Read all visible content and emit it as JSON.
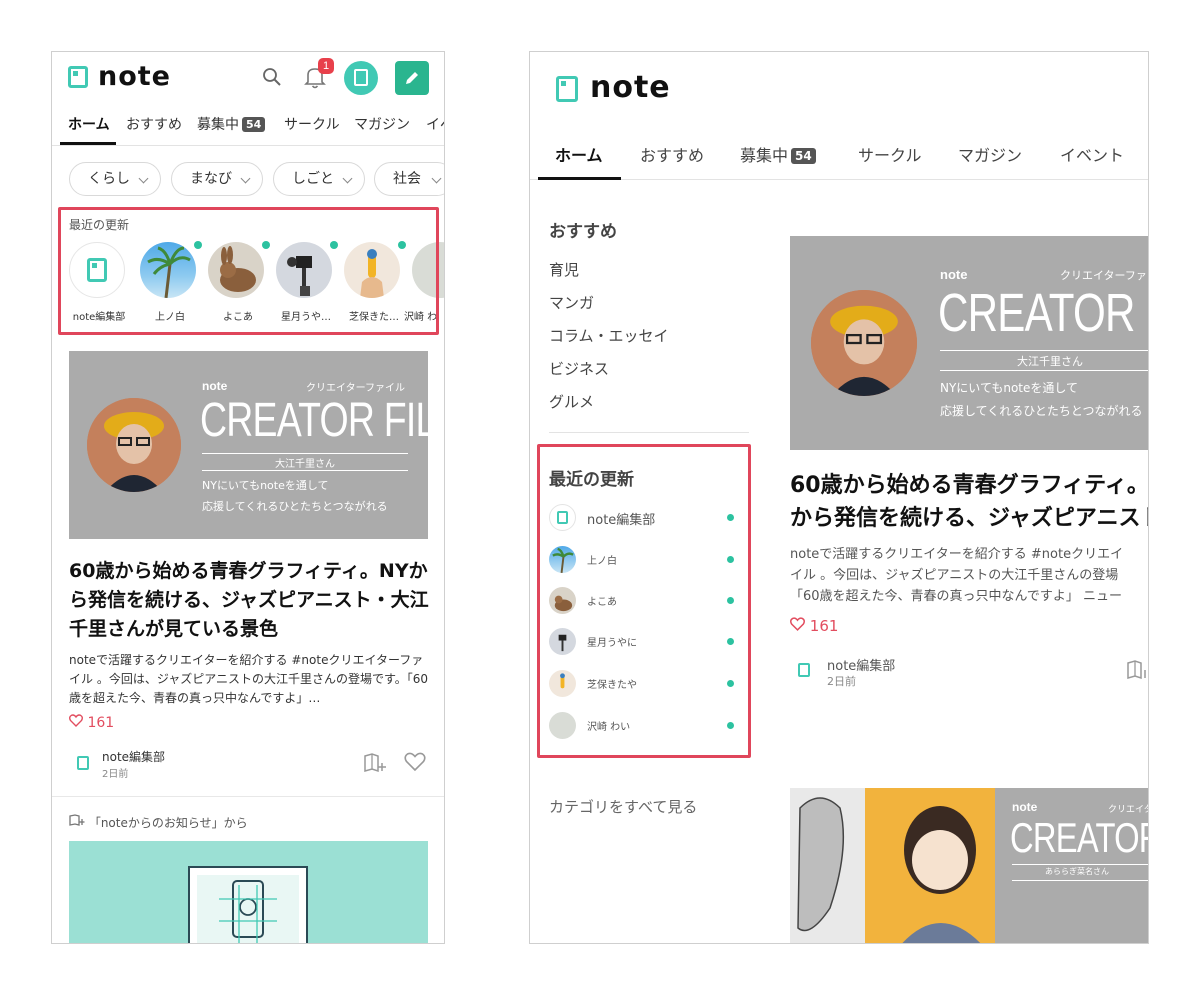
{
  "colors": {
    "accent": "#41c9b4",
    "highlight": "#e0465b",
    "like": "#e24d5f",
    "online": "#2cc2a0"
  },
  "left": {
    "logo": "note",
    "notification_count": "1",
    "tabs": [
      {
        "label": "ホーム",
        "active": true
      },
      {
        "label": "おすすめ"
      },
      {
        "label": "募集中",
        "count": "54"
      },
      {
        "label": "サークル"
      },
      {
        "label": "マガジン"
      },
      {
        "label": "イベ"
      }
    ],
    "chips": [
      "くらし",
      "まなび",
      "しごと",
      "社会"
    ],
    "recent_title": "最近の更新",
    "recent": [
      {
        "name": "note編集部",
        "icon": "note-logo-icon"
      },
      {
        "name": "上ノ白",
        "icon": "palm-tree-photo"
      },
      {
        "name": "よこあ",
        "icon": "rabbit-photo"
      },
      {
        "name": "星月うや…",
        "icon": "camera-photo"
      },
      {
        "name": "芝保きた…",
        "icon": "illustration-photo"
      },
      {
        "name": "沢崎 わ",
        "icon": "gray-photo"
      }
    ],
    "banner": {
      "note": "note",
      "label": "クリエイターファイル",
      "title": "CREATOR FILE",
      "name": "大江千里さん",
      "desc1": "NYにいてもnoteを通して",
      "desc2": "応援してくれるひとたちとつながれる"
    },
    "article": {
      "title": "60歳から始める青春グラフィティ。NYから発信を続ける、ジャズピアニスト・大江千里さんが見ている景色",
      "desc": "noteで活躍するクリエイターを紹介する #noteクリエイターファイル 。今回は、ジャズピアニストの大江千里さんの登場です。「60歳を超えた今、青春の真っ只中なんですよ」…",
      "likes": "161",
      "author": "note編集部",
      "time": "2日前"
    },
    "source": "「noteからのお知らせ」から"
  },
  "right": {
    "logo": "note",
    "tabs": [
      {
        "label": "ホーム",
        "active": true
      },
      {
        "label": "おすすめ"
      },
      {
        "label": "募集中",
        "count": "54"
      },
      {
        "label": "サークル"
      },
      {
        "label": "マガジン"
      },
      {
        "label": "イベント"
      }
    ],
    "sidebar": {
      "recommend_title": "おすすめ",
      "recommend_items": [
        "育児",
        "マンガ",
        "コラム・エッセイ",
        "ビジネス",
        "グルメ"
      ],
      "recent_title": "最近の更新",
      "recent": [
        {
          "name": "note編集部",
          "icon": "note-logo-icon"
        },
        {
          "name": "上ノ白",
          "icon": "palm-tree-photo"
        },
        {
          "name": "よこあ",
          "icon": "rabbit-photo"
        },
        {
          "name": "星月うやに",
          "icon": "camera-photo"
        },
        {
          "name": "芝保きたや",
          "icon": "illustration-photo"
        },
        {
          "name": "沢崎 わい",
          "icon": "gray-photo"
        }
      ],
      "all_categories": "カテゴリをすべて見る"
    },
    "banner": {
      "note": "note",
      "label": "クリエイターファ",
      "title": "CREATOR FIL",
      "name": "大江千里さん",
      "desc1": "NYにいてもnoteを通して",
      "desc2": "応援してくれるひとたちとつながれる"
    },
    "article": {
      "title_line1": "60歳から始める青春グラフィティ。",
      "title_line2": "から発信を続ける、ジャズピアニスト",
      "desc_line1": "noteで活躍するクリエイターを紹介する #noteクリエイ",
      "desc_line2": "イル 。今回は、ジャズピアニストの大江千里さんの登場",
      "desc_line3": "「60歳を超えた今、青春の真っ只中なんですよ」 ニュー",
      "likes": "161",
      "author": "note編集部",
      "time": "2日前"
    },
    "banner2": {
      "note": "note",
      "label": "クリエイタ",
      "title": "CREATOR F",
      "name": "あららぎ菜名さん"
    }
  }
}
